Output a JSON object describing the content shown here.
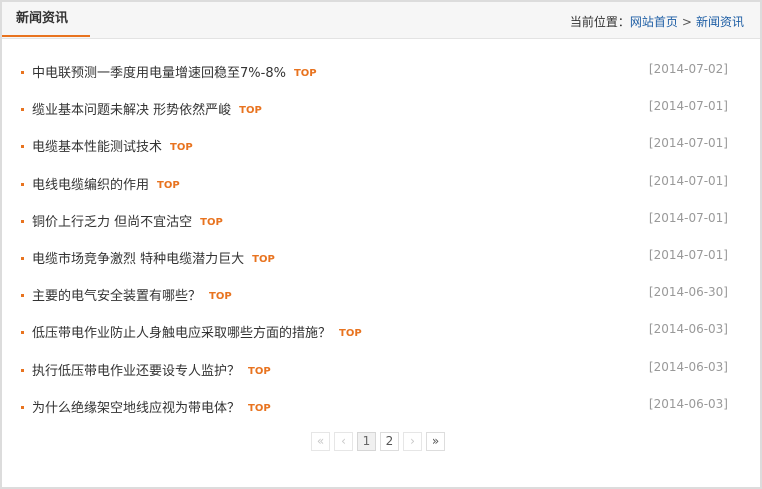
{
  "header": {
    "title": "新闻资讯",
    "breadcrumb": {
      "prefix": "当前位置：",
      "home": "网站首页",
      "separator": ">",
      "current": "新闻资讯"
    }
  },
  "news": {
    "badge_label": "TOP",
    "items": [
      {
        "title": "中电联预测一季度用电量增速回稳至7%-8%",
        "date": "[2014-07-02]"
      },
      {
        "title": "缆业基本问题未解决 形势依然严峻",
        "date": "[2014-07-01]"
      },
      {
        "title": "电缆基本性能测试技术",
        "date": "[2014-07-01]"
      },
      {
        "title": "电线电缆编织的作用",
        "date": "[2014-07-01]"
      },
      {
        "title": "铜价上行乏力 但尚不宜沽空",
        "date": "[2014-07-01]"
      },
      {
        "title": "电缆市场竞争激烈 特种电缆潜力巨大",
        "date": "[2014-07-01]"
      },
      {
        "title": "主要的电气安全装置有哪些？",
        "date": "[2014-06-30]"
      },
      {
        "title": "低压带电作业防止人身触电应采取哪些方面的措施？",
        "date": "[2014-06-03]"
      },
      {
        "title": "执行低压带电作业还要设专人监护？",
        "date": "[2014-06-03]"
      },
      {
        "title": "为什么绝缘架空地线应视为带电体？",
        "date": "[2014-06-03]"
      }
    ]
  },
  "pagination": {
    "first": "«",
    "prev": "‹",
    "pages": [
      "1",
      "2"
    ],
    "current_page": "1",
    "next": "›",
    "last": "»"
  },
  "colors": {
    "accent": "#e8731f",
    "link": "#1f5fa5",
    "date": "#999999"
  }
}
